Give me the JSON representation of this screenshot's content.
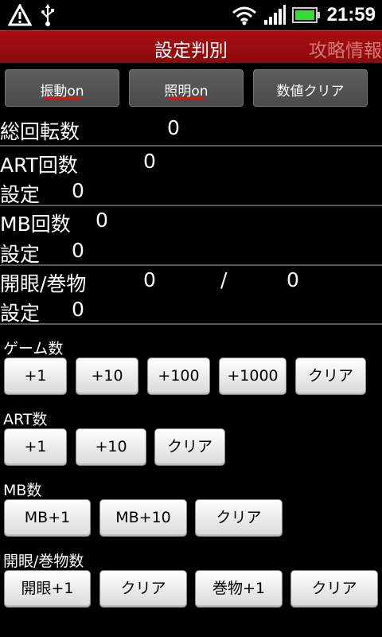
{
  "statusbar": {
    "time": "21:59",
    "icons": [
      "warning-icon",
      "usb-icon",
      "wifi-icon",
      "signal-icon",
      "battery-icon"
    ]
  },
  "titlebar": {
    "title": "設定判別",
    "link": "攻略情報"
  },
  "top_buttons": [
    {
      "label": "振動on",
      "underline": true
    },
    {
      "label": "照明on",
      "underline": true
    },
    {
      "label": "数値クリア",
      "underline": false
    }
  ],
  "stats": {
    "total_spins_label": "総回転数",
    "total_spins_value": "0",
    "art_count_label": "ART回数",
    "art_count_value": "0",
    "art_setting_label": "設定",
    "art_setting_value": "0",
    "mb_count_label": "MB回数",
    "mb_count_value": "0",
    "mb_setting_label": "設定",
    "mb_setting_value": "0",
    "eye_scroll_label": "開眼/巻物",
    "eye_value": "0",
    "separator": "/",
    "scroll_value": "0",
    "eye_setting_label": "設定",
    "eye_setting_value": "0"
  },
  "sections": {
    "games": {
      "label": "ゲーム数",
      "buttons": [
        "+1",
        "+10",
        "+100",
        "+1000",
        "クリア"
      ]
    },
    "art": {
      "label": "ART数",
      "buttons": [
        "+1",
        "+10",
        "クリア"
      ]
    },
    "mb": {
      "label": "MB数",
      "buttons": [
        "MB+1",
        "MB+10",
        "クリア"
      ]
    },
    "eye_scroll": {
      "label": "開眼/巻物数",
      "buttons": [
        "開眼+1",
        "クリア",
        "巻物+1",
        "クリア"
      ]
    }
  },
  "colors": {
    "titlebar": "#9c0d10",
    "title_link": "#d27a74",
    "underline": "#e40f0f",
    "battery": "#33dd33"
  }
}
